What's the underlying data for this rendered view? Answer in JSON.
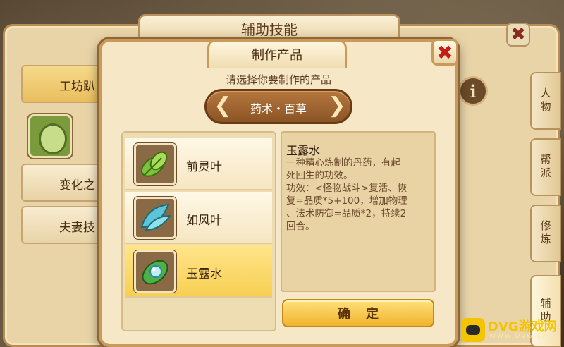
{
  "back_panel": {
    "title": "辅助技能",
    "close_glyph": "✖",
    "left_items": [
      {
        "label": "工坊趴",
        "selected": true
      },
      {
        "label": "变化之",
        "selected": false
      },
      {
        "label": "夫妻技",
        "selected": false
      }
    ],
    "info_glyph": "i",
    "side_tabs": [
      {
        "label": "人物",
        "active": false
      },
      {
        "label": "帮派",
        "active": false
      },
      {
        "label": "修炼",
        "active": false
      },
      {
        "label": "辅助",
        "active": true
      }
    ]
  },
  "dialog": {
    "title": "制作产品",
    "close_glyph": "✖",
    "prompt": "请选择你要制作的产品",
    "category": {
      "label": "药术・百草",
      "prev_glyph": "❮",
      "next_glyph": "❯"
    },
    "products": [
      {
        "name": "前灵叶",
        "icon": "green-leaf-icon",
        "selected": false
      },
      {
        "name": "如风叶",
        "icon": "blue-leaf-icon",
        "selected": false
      },
      {
        "name": "玉露水",
        "icon": "dew-leaf-icon",
        "selected": true
      }
    ],
    "detail": {
      "title": "玉露水",
      "description": "一种精心炼制的丹药，有起\n死回生的功效。\n功效：<怪物战斗>复活、恢\n复=品质*5+100，增加物理\n、法术防御=品质*2，持续2\n回合。"
    },
    "confirm_label": "确定"
  },
  "watermark": {
    "text": "DVG游戏网",
    "sub": "WWW.DVG.CN"
  },
  "colors": {
    "panel_bg": "#f6e8c6",
    "border": "#c99a5a",
    "selected_item": "#f7cf52",
    "confirm_button": "#f0b42e",
    "close_red": "#c41d16"
  }
}
